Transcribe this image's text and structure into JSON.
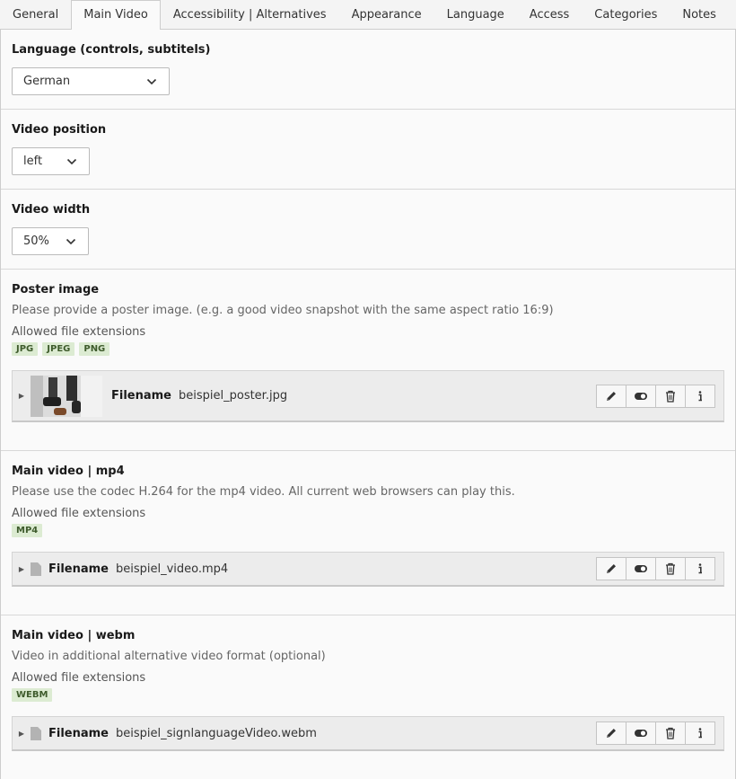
{
  "tabs": [
    {
      "label": "General"
    },
    {
      "label": "Main Video"
    },
    {
      "label": "Accessibility | Alternatives"
    },
    {
      "label": "Appearance"
    },
    {
      "label": "Language"
    },
    {
      "label": "Access"
    },
    {
      "label": "Categories"
    },
    {
      "label": "Notes"
    }
  ],
  "active_tab": "Main Video",
  "language": {
    "label": "Language (controls, subtitels)",
    "value": "German"
  },
  "position": {
    "label": "Video position",
    "value": "left"
  },
  "width": {
    "label": "Video width",
    "value": "50%"
  },
  "poster": {
    "label": "Poster image",
    "description": "Please provide a poster image. (e.g. a good video snapshot with the same aspect ratio 16:9)",
    "allowed_label": "Allowed file extensions",
    "extensions": [
      "JPG",
      "JPEG",
      "PNG"
    ],
    "file_label": "Filename",
    "filename": "beispiel_poster.jpg"
  },
  "mp4": {
    "label": "Main video | mp4",
    "description": "Please use the codec H.264 for the mp4 video. All current web browsers can play this.",
    "allowed_label": "Allowed file extensions",
    "extensions": [
      "MP4"
    ],
    "file_label": "Filename",
    "filename": "beispiel_video.mp4"
  },
  "webm": {
    "label": "Main video | webm",
    "description": "Video in additional alternative video format (optional)",
    "allowed_label": "Allowed file extensions",
    "extensions": [
      "WEBM"
    ],
    "file_label": "Filename",
    "filename": "beispiel_signlanguageVideo.webm"
  },
  "colors": {
    "badge_bg": "#dcebd2",
    "badge_text": "#3e5b2c",
    "row_bg": "#ececec"
  }
}
